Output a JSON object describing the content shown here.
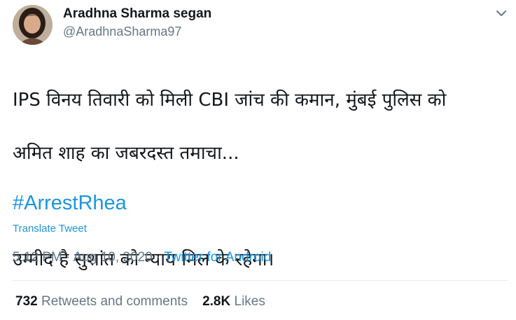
{
  "author": {
    "name": "Aradhna Sharma segan",
    "handle": "@AradhnaSharma97"
  },
  "tweet": {
    "line1": "IPS विनय तिवारी को मिली CBI जांच की कमान, मुंबई पुलिस को",
    "line2": "अमित शाह का जबरदस्त तमाचा...",
    "line3": "उम्मीद है सुशांत को न्याय मिल के रहेगा।",
    "hashtag": "#ArrestRhea",
    "translate_label": "Translate Tweet"
  },
  "meta": {
    "time": "5:12 PM",
    "sep1": " · ",
    "date": "Aug 10, 2020",
    "sep2": " · ",
    "source": "Twitter for Android"
  },
  "stats": {
    "retweets_count": "732",
    "retweets_label": "Retweets and comments",
    "likes_count": "2.8K",
    "likes_label": "Likes"
  },
  "colors": {
    "link": "#1b95e0",
    "secondary": "#657786",
    "primary": "#14171a",
    "divider": "#e6ecf0"
  },
  "icons": {
    "menu": "chevron-down-icon"
  }
}
